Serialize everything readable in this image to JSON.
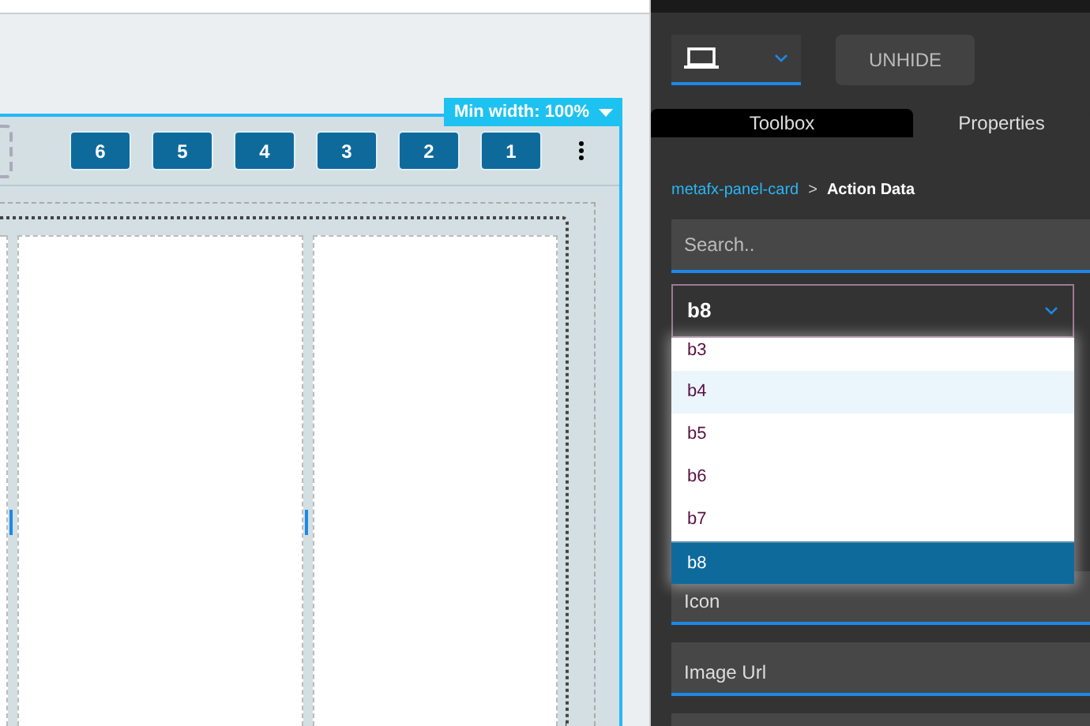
{
  "canvas": {
    "min_width_label": "Min width: 100%",
    "toolbar_buttons": [
      "6",
      "5",
      "4",
      "3",
      "2",
      "1"
    ]
  },
  "panel": {
    "unhide_button": "UNHIDE",
    "tabs": [
      {
        "label": "Toolbox",
        "selected": true
      },
      {
        "label": "Properties",
        "selected": false
      }
    ],
    "breadcrumb": {
      "link": "metafx-panel-card",
      "separator": ">",
      "current": "Action Data"
    },
    "search": {
      "placeholder": "Search.."
    },
    "select": {
      "value": "b8",
      "expanded": true,
      "options": [
        {
          "label": "b3",
          "selected": false,
          "highlighted": false
        },
        {
          "label": "b4",
          "selected": false,
          "highlighted": true
        },
        {
          "label": "b5",
          "selected": false,
          "highlighted": false
        },
        {
          "label": "b6",
          "selected": false,
          "highlighted": false
        },
        {
          "label": "b7",
          "selected": false,
          "highlighted": false
        },
        {
          "label": "b8",
          "selected": true,
          "highlighted": false
        }
      ]
    },
    "fields": [
      {
        "placeholder": "Icon"
      },
      {
        "placeholder": "Image Url"
      }
    ]
  }
}
